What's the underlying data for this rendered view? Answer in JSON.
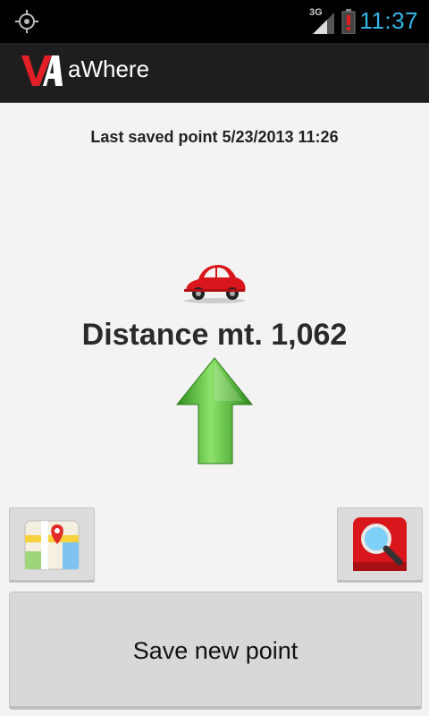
{
  "statusbar": {
    "network_label": "3G",
    "time": "11:37",
    "icons": {
      "left": "gps-icon",
      "signal": "signal-icon",
      "battery": "battery-alert-icon"
    }
  },
  "actionbar": {
    "title": "aWhere",
    "logo": "app-logo"
  },
  "main": {
    "last_saved": "Last saved point 5/23/2013 11:26",
    "distance": "Distance mt. 1,062",
    "car_icon": "car-icon",
    "arrow_icon": "green-arrow-up-icon"
  },
  "buttons": {
    "map_icon": "map-icon",
    "search_icon": "search-icon",
    "save_label": "Save new point"
  },
  "colors": {
    "status_time": "#33b5e5",
    "actionbar_bg": "#1e1e1e",
    "arrow_green": "#3fae2a",
    "car_red": "#d8161b",
    "search_red": "#d8161b"
  }
}
